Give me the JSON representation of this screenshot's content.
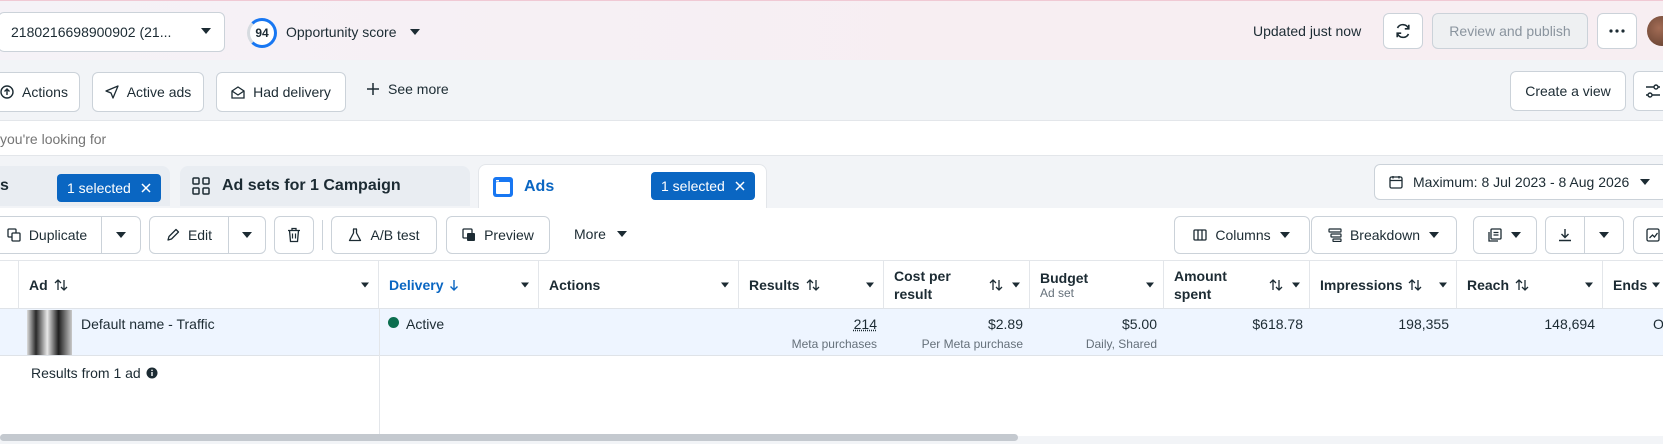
{
  "topbar": {
    "account_id": "2180216698900902 (21...",
    "opportunity_score": "94",
    "opportunity_label": "Opportunity score",
    "updated_text": "Updated just now",
    "review_publish": "Review and publish"
  },
  "filters": {
    "actions": "Actions",
    "active_ads": "Active ads",
    "had_delivery": "Had delivery",
    "see_more": "See more",
    "create_view": "Create a view"
  },
  "search": {
    "placeholder": "you're looking for"
  },
  "tabs": {
    "campaigns_suffix": "s",
    "campaigns_chip": "1 selected",
    "adsets_label": "Ad sets for 1 Campaign",
    "ads_label": "Ads",
    "ads_chip": "1 selected"
  },
  "date_range": "Maximum: 8 Jul 2023 - 8 Aug 2026",
  "toolbar": {
    "duplicate": "Duplicate",
    "edit": "Edit",
    "ab_test": "A/B test",
    "preview": "Preview",
    "more": "More",
    "columns": "Columns",
    "breakdown": "Breakdown"
  },
  "table": {
    "headers": {
      "ad": "Ad",
      "delivery": "Delivery",
      "actions": "Actions",
      "results": "Results",
      "cost_per_result": "Cost per result",
      "budget": "Budget",
      "budget_sub": "Ad set",
      "amount_spent": "Amount spent",
      "impressions": "Impressions",
      "reach": "Reach",
      "ends": "Ends"
    },
    "row": {
      "ad_name": "Default name - Traffic",
      "delivery": "Active",
      "results": "214",
      "results_sub": "Meta purchases",
      "cost_per_result": "$2.89",
      "cost_sub": "Per Meta purchase",
      "budget": "$5.00",
      "budget_sub": "Daily, Shared",
      "amount_spent": "$618.78",
      "impressions": "198,355",
      "reach": "148,694",
      "ends": "O"
    },
    "footer": "Results from 1 ad"
  },
  "colors": {
    "accent": "#0a66c2",
    "active_dot": "#0b6e4f"
  }
}
